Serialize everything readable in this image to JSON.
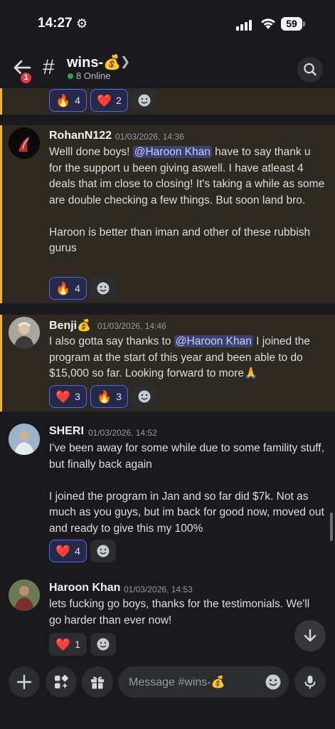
{
  "status_bar": {
    "time": "14:27",
    "battery": "59"
  },
  "header": {
    "back_badge": "1",
    "channel_name": "wins-💰",
    "online": "8 Online",
    "icons": [
      "back-arrow-icon",
      "hash-icon",
      "chevron-right-icon",
      "search-icon"
    ]
  },
  "partial_message": {
    "reactions": [
      {
        "emoji": "🔥",
        "count": "4"
      },
      {
        "emoji": "❤️",
        "count": "2"
      }
    ]
  },
  "messages": [
    {
      "author": "RohanN122",
      "timestamp": "01/03/2026, 14:36",
      "text_before": "Welll done boys! ",
      "mention": "@Haroon Khan",
      "text_after": "  have to say thank u for the support u been giving aswell. I have atleast 4 deals that im close to closing! It's taking a while as some are double checking a few things. But soon land bro.\n\nHaroon is better than iman and other of these rubbish gurus",
      "reactions": [
        {
          "emoji": "🔥",
          "count": "4"
        }
      ]
    },
    {
      "author": "Benji💰",
      "timestamp": "01/03/2026, 14:46",
      "text_before": "I also gotta say thanks to ",
      "mention": "@Haroon Khan",
      "text_after": " I joined the program at the start of this year and been able to do $15,000 so far. Looking forward to more🙏",
      "reactions": [
        {
          "emoji": "❤️",
          "count": "3"
        },
        {
          "emoji": "🔥",
          "count": "3"
        }
      ]
    },
    {
      "author": "SHERI",
      "timestamp": "01/03/2026, 14:52",
      "text": "I've been away for some while due to some famility stuff, but finally back again\n\nI joined the program in Jan and so far did $7k. Not as much as you guys, but im back for good now, moved out and ready to give this my 100%",
      "reactions": [
        {
          "emoji": "❤️",
          "count": "4"
        }
      ]
    },
    {
      "author": "Haroon Khan",
      "timestamp": "01/03/2026, 14:53",
      "text": "lets fucking go boys, thanks for the testimonials. We'll go harder than ever now!",
      "reactions": [
        {
          "emoji": "❤️",
          "count": "1"
        }
      ]
    }
  ],
  "composer": {
    "placeholder": "Message #wins-💰",
    "icons": [
      "plus-icon",
      "apps-icon",
      "gift-icon",
      "emoji-icon",
      "microphone-icon"
    ]
  },
  "colors": {
    "accent": "#5865f2",
    "highlight_bar": "#f0b232",
    "online": "#23a55a",
    "badge": "#e03b3f"
  }
}
